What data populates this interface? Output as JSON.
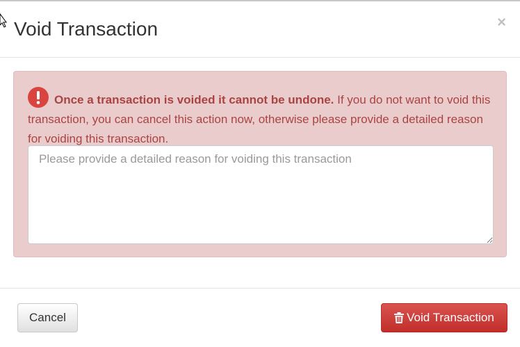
{
  "modal": {
    "title": "Void Transaction",
    "close_label": "×"
  },
  "alert": {
    "icon": "exclamation-circle-icon",
    "bold_text": "Once a transaction is voided it cannot be undone.",
    "body_text": " If you do not want to void this transaction, you can cancel this action now, otherwise please provide a detailed reason for voiding this transaction.",
    "color": "#a94442",
    "background": "#ebcccc"
  },
  "reason": {
    "placeholder": "Please provide a detailed reason for voiding this transaction",
    "value": ""
  },
  "footer": {
    "cancel_label": "Cancel",
    "void_label": "Void Transaction",
    "void_icon": "trash-icon",
    "void_color": "#d9534f"
  }
}
